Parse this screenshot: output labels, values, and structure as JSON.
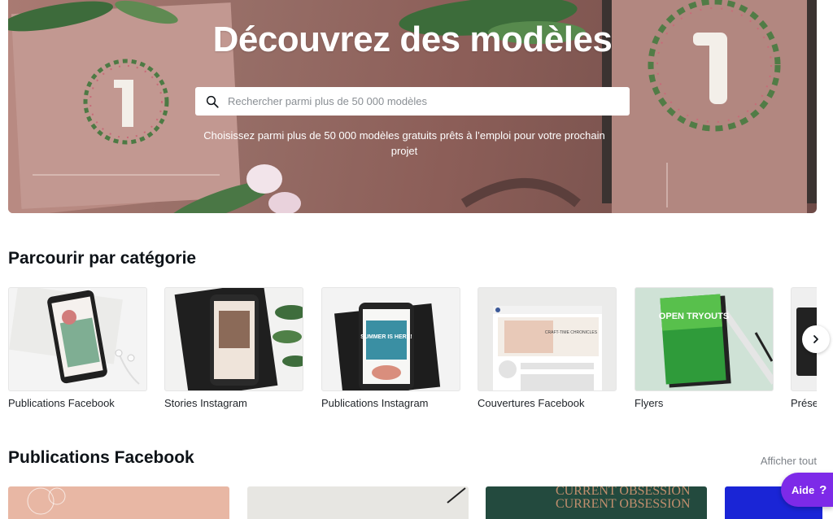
{
  "hero": {
    "title": "Découvrez des modèles",
    "search_placeholder": "Rechercher parmi plus de 50 000 modèles",
    "subtitle": "Choisissez parmi plus de 50 000 modèles gratuits prêts à l’emploi pour votre prochain projet"
  },
  "categories": {
    "heading": "Parcourir par catégorie",
    "items": [
      {
        "label": "Publications Facebook"
      },
      {
        "label": "Stories Instagram"
      },
      {
        "label": "Publications Instagram"
      },
      {
        "label": "Couvertures Facebook"
      },
      {
        "label": "Flyers"
      },
      {
        "label": "Prése"
      }
    ]
  },
  "facebook_section": {
    "heading": "Publications Facebook",
    "see_all": "Afficher tout"
  },
  "help": {
    "label": "Aide",
    "icon": "?"
  },
  "thumb_text": {
    "summer": "SUMMER IS HERE!",
    "open": "OPEN TRYOUTS",
    "craft": "CRAFT-TIME CHRONICLES",
    "obsession": "CURRENT OBSESSION"
  },
  "colors": {
    "accent": "#7d2ae8",
    "hero": "#8c5e58"
  }
}
